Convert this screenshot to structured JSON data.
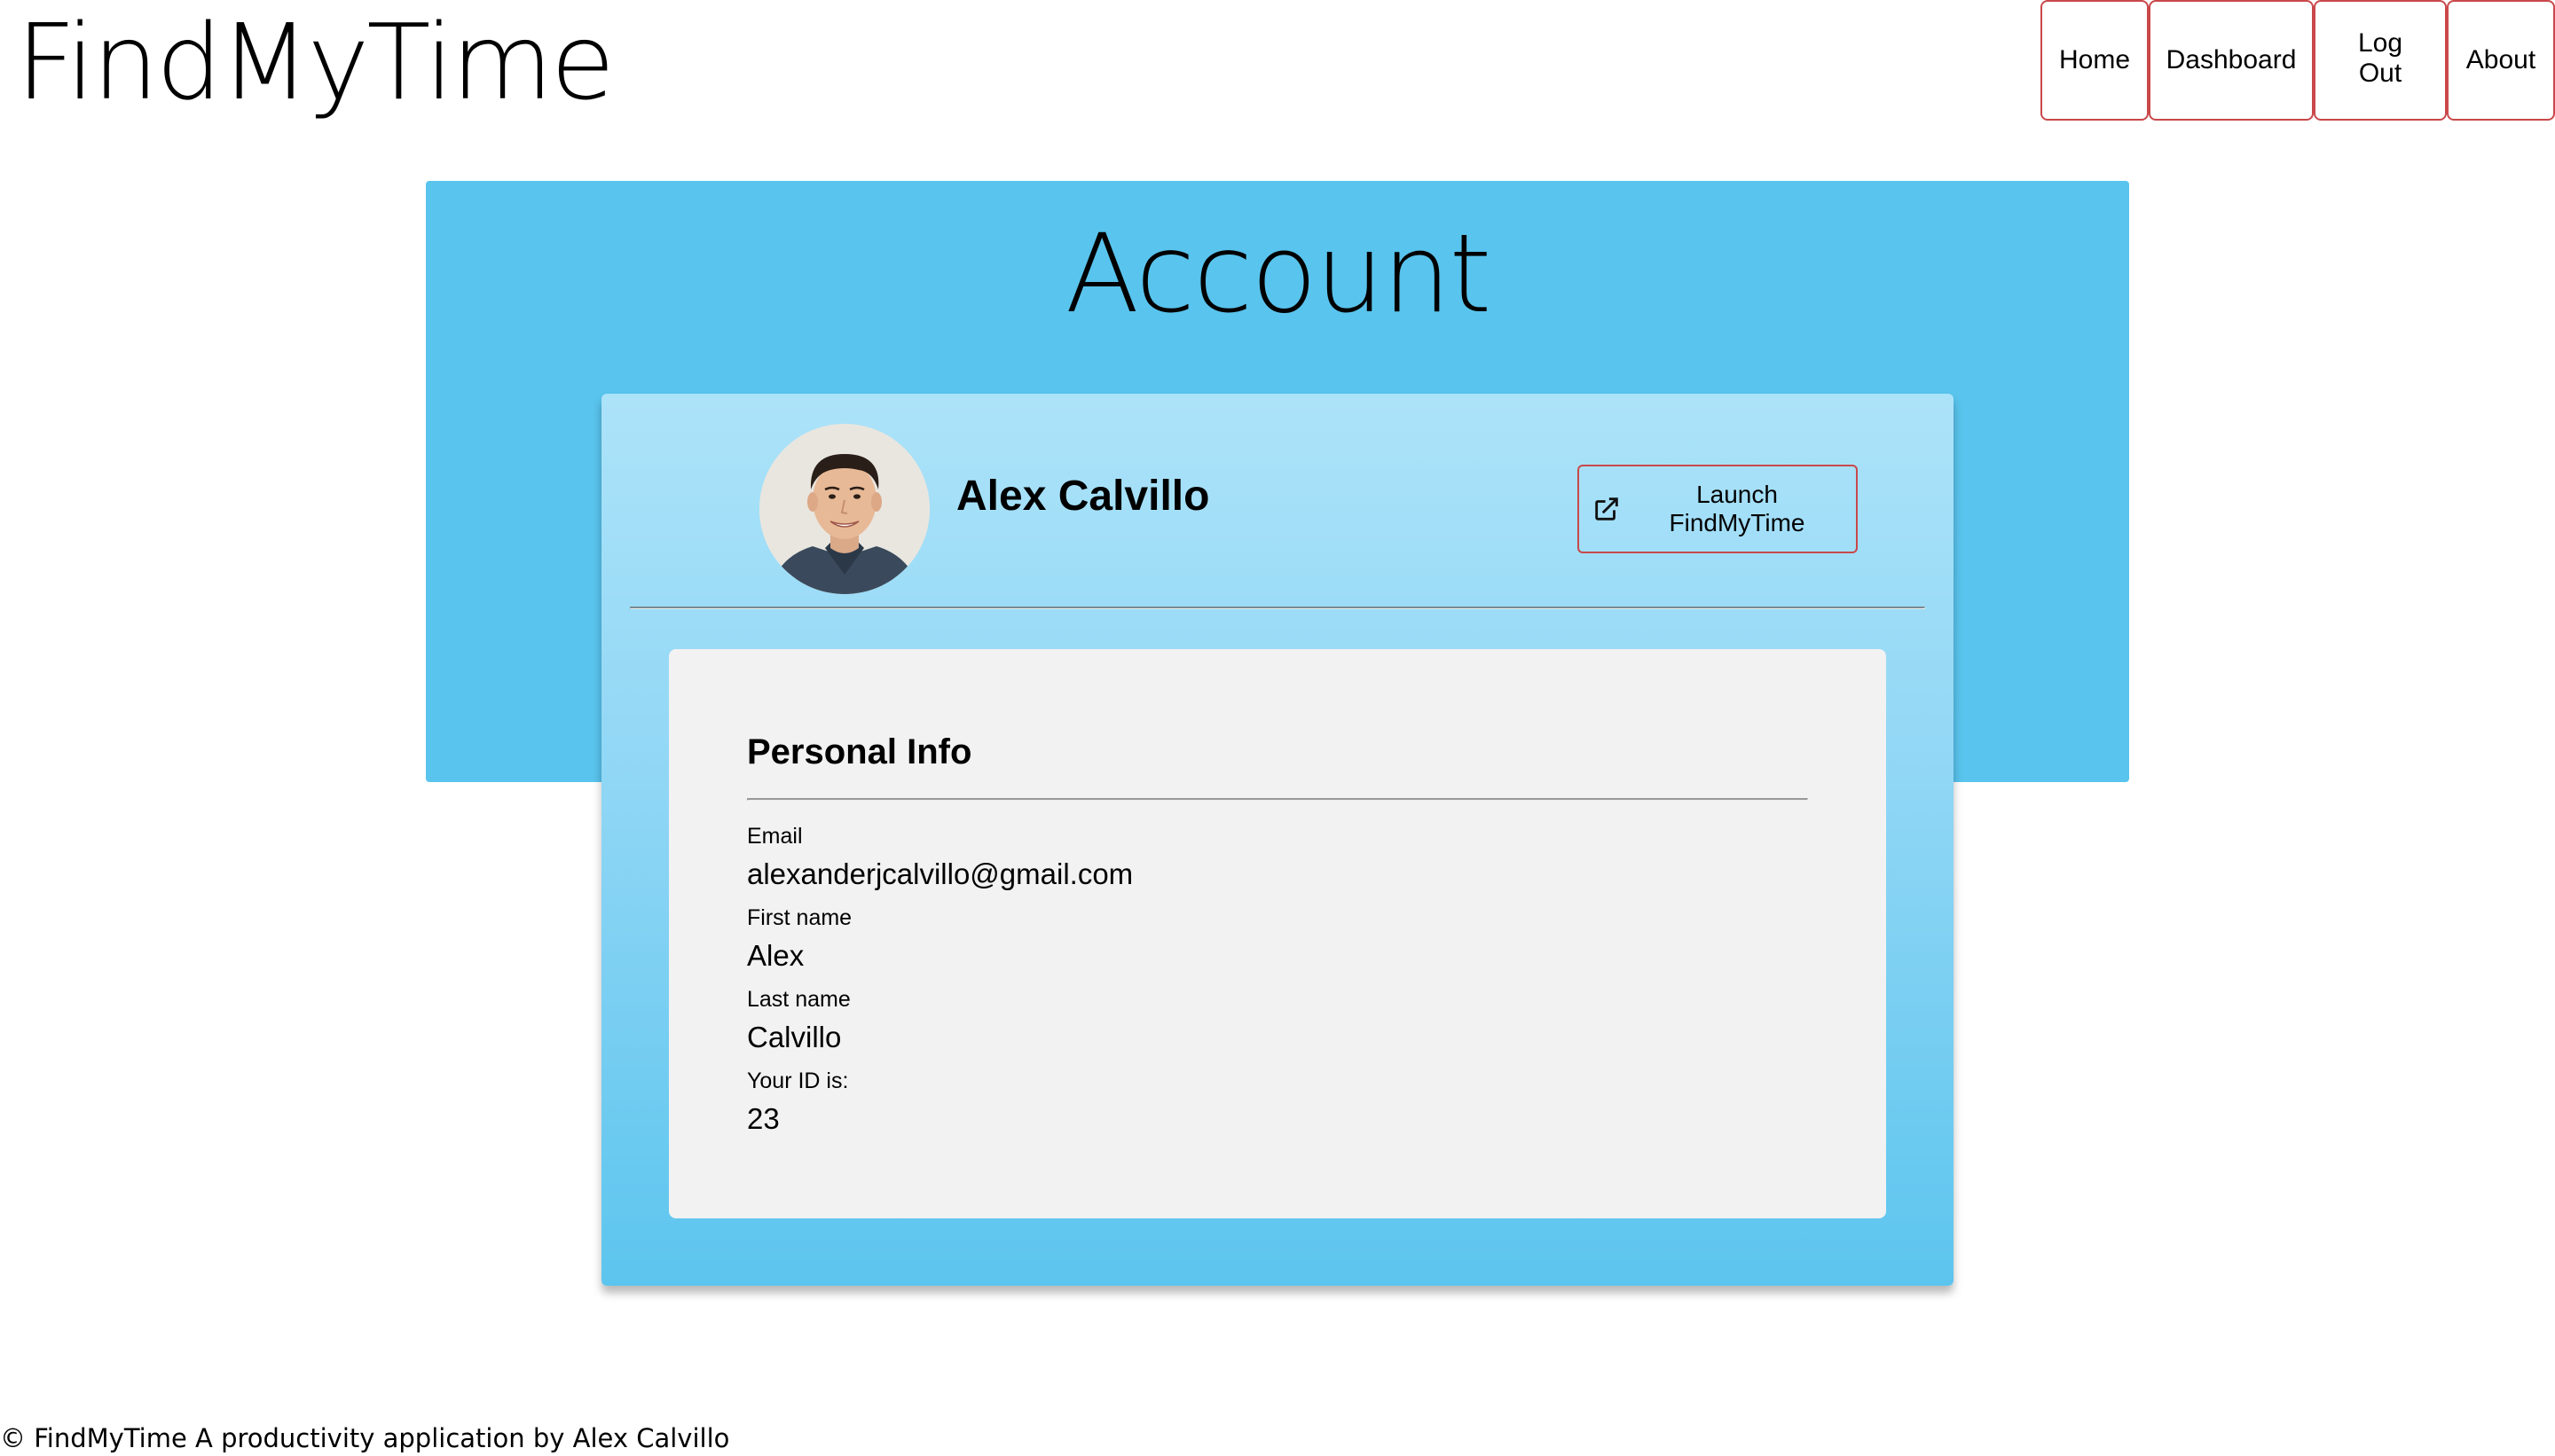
{
  "header": {
    "brand": "FindMyTime",
    "nav": [
      {
        "label": "Home"
      },
      {
        "label": "Dashboard"
      },
      {
        "label": "Log Out"
      },
      {
        "label": "About"
      }
    ]
  },
  "hero": {
    "title": "Account"
  },
  "profile": {
    "name": "Alex Calvillo",
    "avatar_icon": "user-photo",
    "launch_label": "Launch FindMyTime",
    "launch_icon": "open-in-new-icon"
  },
  "personal_info": {
    "title": "Personal Info",
    "fields": [
      {
        "label": "Email",
        "value": "alexanderjcalvillo@gmail.com"
      },
      {
        "label": "First name",
        "value": "Alex"
      },
      {
        "label": "Last name",
        "value": "Calvillo"
      },
      {
        "label": "Your ID is:",
        "value": "23"
      }
    ]
  },
  "footer": {
    "text": "© FindMyTime A productivity application by Alex Calvillo"
  },
  "colors": {
    "hero_bg": "#59c4ed",
    "card_top": "#ace3f9",
    "card_bottom": "#5cc5ee",
    "button_border": "#c9484a",
    "panel_bg": "#f2f2f2"
  }
}
